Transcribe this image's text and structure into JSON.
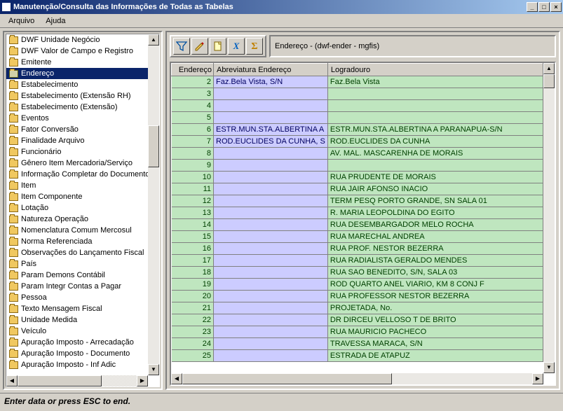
{
  "window": {
    "title": "Manutenção/Consulta das Informações de Todas as Tabelas"
  },
  "menu": {
    "items": [
      "Arquivo",
      "Ajuda"
    ]
  },
  "tree": {
    "items": [
      "DWF Unidade Negócio",
      "DWF Valor de Campo e Registro",
      "Emitente",
      "Endereço",
      "Estabelecimento",
      "Estabelecimento  (Extensão RH)",
      "Estabelecimento (Extensão)",
      "Eventos",
      "Fator Conversão",
      "Finalidade Arquivo",
      "Funcionário",
      "Gênero Item Mercadoria/Serviço",
      "Informação Completar do Documento",
      "Item",
      "Item Componente",
      "Lotação",
      "Natureza Operação",
      "Nomenclatura Comum Mercosul",
      "Norma Referenciada",
      "Observações do Lançamento Fiscal",
      "País",
      "Param Demons Contábil",
      "Param Integr Contas a Pagar",
      "Pessoa",
      "Texto Mensagem Fiscal",
      "Unidade Medida",
      "Veículo",
      "Apuração Imposto - Arrecadação",
      "Apuração Imposto - Documento",
      "Apuração Imposto - Inf Adic"
    ],
    "selected": 3
  },
  "toolbar": {
    "info": "Endereço - (dwf-ender - mgfis)"
  },
  "grid": {
    "columns": [
      "Endereço",
      "Abreviatura Endereço",
      "Logradouro"
    ],
    "rows": [
      {
        "id": "2",
        "abrev": "Faz.Bela Vista, S/N",
        "log": "Faz.Bela Vista"
      },
      {
        "id": "3",
        "abrev": "",
        "log": ""
      },
      {
        "id": "4",
        "abrev": "",
        "log": ""
      },
      {
        "id": "5",
        "abrev": "",
        "log": ""
      },
      {
        "id": "6",
        "abrev": "ESTR.MUN.STA.ALBERTINA A",
        "log": "ESTR.MUN.STA.ALBERTINA A PARANAPUA-S/N"
      },
      {
        "id": "7",
        "abrev": "ROD.EUCLIDES DA CUNHA, S",
        "log": "ROD.EUCLIDES DA CUNHA"
      },
      {
        "id": "8",
        "abrev": "",
        "log": "AV. MAL. MASCARENHA DE MORAIS"
      },
      {
        "id": "9",
        "abrev": "",
        "log": ""
      },
      {
        "id": "10",
        "abrev": "",
        "log": "RUA PRUDENTE DE MORAIS"
      },
      {
        "id": "11",
        "abrev": "",
        "log": "RUA JAIR AFONSO INACIO"
      },
      {
        "id": "12",
        "abrev": "",
        "log": "TERM PESQ PORTO GRANDE, SN SALA 01"
      },
      {
        "id": "13",
        "abrev": "",
        "log": "R. MARIA LEOPOLDINA DO EGITO"
      },
      {
        "id": "14",
        "abrev": "",
        "log": "RUA DESEMBARGADOR MELO ROCHA"
      },
      {
        "id": "15",
        "abrev": "",
        "log": "RUA MARECHAL ANDREA"
      },
      {
        "id": "16",
        "abrev": "",
        "log": "RUA PROF. NESTOR BEZERRA"
      },
      {
        "id": "17",
        "abrev": "",
        "log": "RUA RADIALISTA GERALDO MENDES"
      },
      {
        "id": "18",
        "abrev": "",
        "log": "RUA SAO BENEDITO, S/N, SALA 03"
      },
      {
        "id": "19",
        "abrev": "",
        "log": "ROD QUARTO ANEL VIARIO, KM 8 CONJ F"
      },
      {
        "id": "20",
        "abrev": "",
        "log": "RUA PROFESSOR NESTOR BEZERRA"
      },
      {
        "id": "21",
        "abrev": "",
        "log": "PROJETADA, No."
      },
      {
        "id": "22",
        "abrev": "",
        "log": "DR DIRCEU VELLOSO T DE BRITO"
      },
      {
        "id": "23",
        "abrev": "",
        "log": "RUA MAURICIO PACHECO"
      },
      {
        "id": "24",
        "abrev": "",
        "log": "TRAVESSA MARACA, S/N"
      },
      {
        "id": "25",
        "abrev": "",
        "log": "ESTRADA DE ATAPUZ"
      }
    ]
  },
  "status": "Enter data or press ESC to end."
}
